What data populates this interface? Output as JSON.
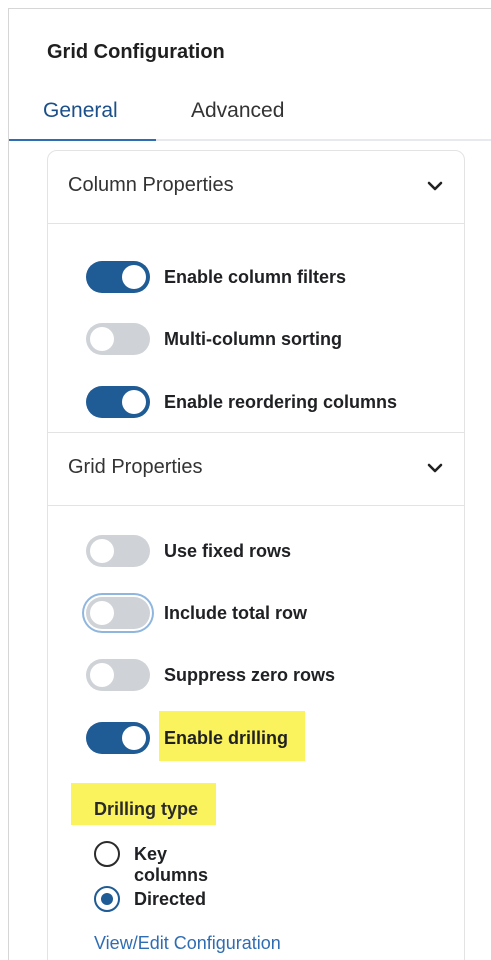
{
  "title": "Grid Configuration",
  "tabs": [
    {
      "label": "General",
      "active": true
    },
    {
      "label": "Advanced",
      "active": false
    }
  ],
  "sections": {
    "column": {
      "label": "Column Properties",
      "icon": "chevron-down-icon",
      "toggles": [
        {
          "label": "Enable column filters",
          "on": true
        },
        {
          "label": "Multi-column sorting",
          "on": false
        },
        {
          "label": "Enable reordering columns",
          "on": true
        }
      ]
    },
    "grid": {
      "label": "Grid Properties",
      "icon": "chevron-down-icon",
      "toggles": [
        {
          "label": "Use fixed rows",
          "on": false
        },
        {
          "label": "Include total row",
          "on": false,
          "focused": true
        },
        {
          "label": "Suppress zero rows",
          "on": false
        },
        {
          "label": "Enable drilling",
          "on": true,
          "highlighted": true
        }
      ]
    }
  },
  "drilling": {
    "label": "Drilling type",
    "options": [
      {
        "label": "Key columns",
        "selected": false
      },
      {
        "label": "Directed",
        "selected": true
      }
    ],
    "link": "View/Edit Configuration"
  },
  "colors": {
    "accent": "#1f5b94",
    "toggle_off": "#cfd3d7",
    "highlight": "#fbf35d",
    "link": "#2f6db3"
  }
}
